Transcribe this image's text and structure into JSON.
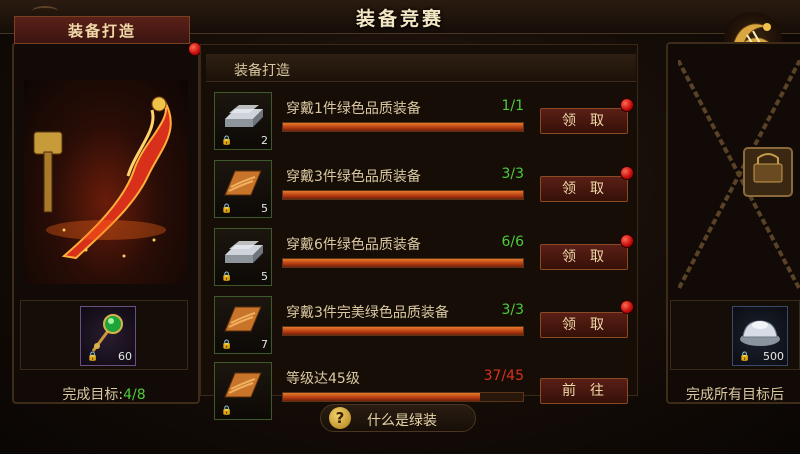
{
  "window": {
    "title": "装备竞赛"
  },
  "left": {
    "header": "装备打造",
    "item_qty": "60",
    "goal_label": "完成目标:",
    "goal_value": "4/8"
  },
  "middle": {
    "header": "装备打造",
    "tasks": [
      {
        "icon": "silver-ingot-icon",
        "qty": "2",
        "label": "穿戴1件绿色品质装备",
        "progress": "1/1",
        "progress_fraction": 1.0,
        "status": "complete",
        "button": "领取"
      },
      {
        "icon": "leather-scroll-icon",
        "qty": "5",
        "label": "穿戴3件绿色品质装备",
        "progress": "3/3",
        "progress_fraction": 1.0,
        "status": "complete",
        "button": "领取"
      },
      {
        "icon": "silver-ingot-icon",
        "qty": "5",
        "label": "穿戴6件绿色品质装备",
        "progress": "6/6",
        "progress_fraction": 1.0,
        "status": "complete",
        "button": "领取"
      },
      {
        "icon": "leather-scroll-icon",
        "qty": "7",
        "label": "穿戴3件完美绿色品质装备",
        "progress": "3/3",
        "progress_fraction": 1.0,
        "status": "complete",
        "button": "领取"
      },
      {
        "icon": "leather-scroll-icon",
        "qty": "",
        "label": "等级达45级",
        "progress": "37/45",
        "progress_fraction": 0.82,
        "status": "incomplete",
        "button": "前往"
      }
    ],
    "help": "什么是绿装"
  },
  "right": {
    "item_qty": "500",
    "goal_label": "完成所有目标后"
  },
  "colors": {
    "complete": "#4ecb3a",
    "incomplete": "#d6321e",
    "accent": "#b43a12"
  }
}
